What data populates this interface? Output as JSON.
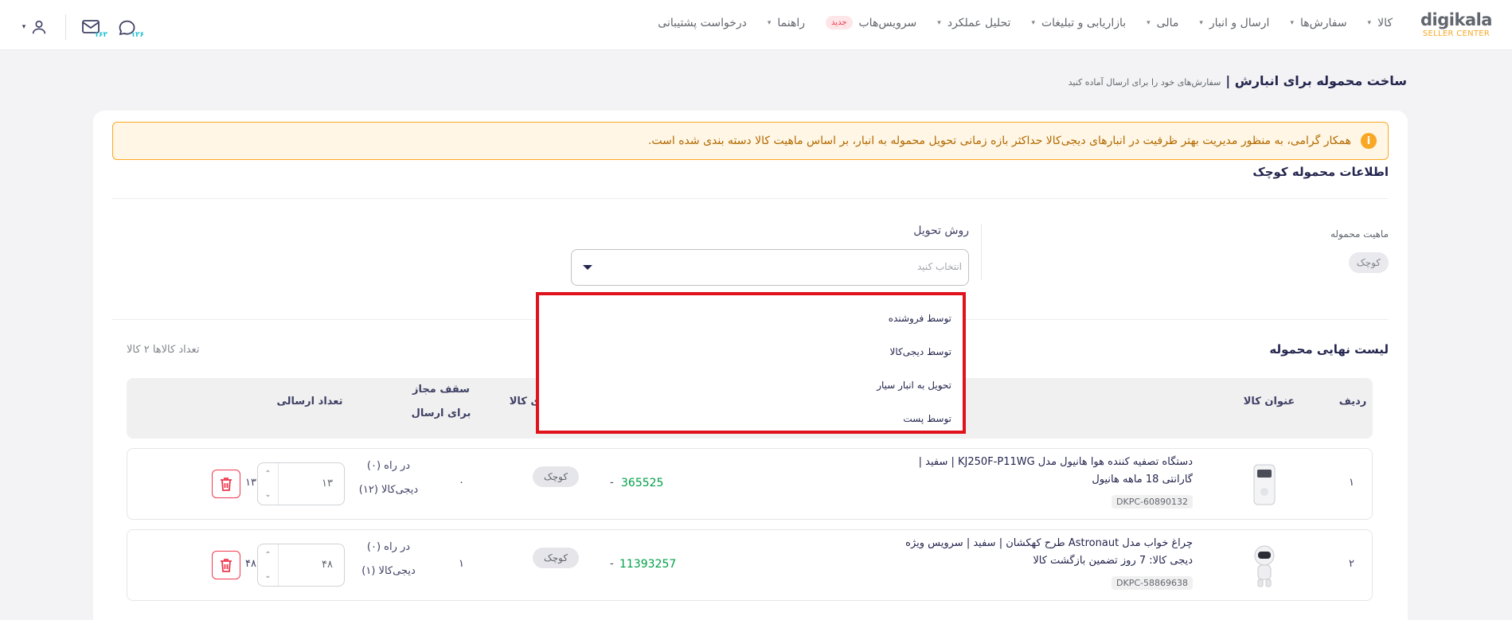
{
  "logo": {
    "line1": "digikala",
    "line2": "SELLER CENTER"
  },
  "nav": [
    {
      "label": "کالا",
      "caret": true
    },
    {
      "label": "سفارش‌ها",
      "caret": true
    },
    {
      "label": "ارسال و انبار",
      "caret": true
    },
    {
      "label": "مالی",
      "caret": true
    },
    {
      "label": "بازاریابی و تبلیغات",
      "caret": true
    },
    {
      "label": "تحلیل عملکرد",
      "caret": true
    },
    {
      "label": "سرویس‌هاب",
      "caret": false,
      "badge": "جدید"
    },
    {
      "label": "راهنما",
      "caret": true
    },
    {
      "label": "درخواست پشتیبانی",
      "caret": false
    }
  ],
  "top_icons": {
    "messages_count": "۱۶۲",
    "sync_count": "۱۲۶"
  },
  "header": {
    "title": "ساخت محموله برای انبارش |",
    "subtitle": "سفارش‌های خود را برای ارسال آماده کنید"
  },
  "alert": {
    "text": "همکار گرامی، به منظور مدیریت بهتر ظرفیت در انبارهای دیجی‌کالا حداکثر بازه زمانی تحویل محموله به انبار، بر اساس ماهیت کالا دسته بندی شده است."
  },
  "section": {
    "title": "اطلاعات محموله کوچک"
  },
  "nature": {
    "label": "ماهیت محموله",
    "value": "کوچک"
  },
  "delivery": {
    "label": "روش تحویل",
    "placeholder": "انتخاب کنید",
    "options": [
      "توسط فروشنده",
      "توسط دیجی‌کالا",
      "تحویل به انبار سیار",
      "توسط پست"
    ]
  },
  "list": {
    "title": "لیست نهایی محموله",
    "count": "تعداد کالاها ۲ کالا"
  },
  "table": {
    "headers": {
      "row": "ردیف",
      "title": "عنوان کالا",
      "dkp_partial": "ی کالا",
      "cap_line1": "سقف مجاز",
      "cap_line2": "برای ارسال",
      "qty": "تعداد ارسالی"
    },
    "rows": [
      {
        "index": "۱",
        "name": "دستگاه تصفیه کننده هوا هانیول مدل KJ250F-P11WG | سفید | گارانتی 18 ماهه هانیول",
        "dkpc": "DKPC-60890132",
        "code": "365525",
        "dash": "-",
        "size": "کوچک",
        "zero": "۰",
        "transit": "در راه (۰)",
        "dk": "دیجی‌کالا (۱۲)",
        "cap": "۱۳",
        "qty": "۱۳"
      },
      {
        "index": "۲",
        "name": "چراغ خواب مدل Astronaut طرح کهکشان | سفید | سرویس ویژه دیجی کالا: 7 روز تضمین بازگشت کالا",
        "dkpc": "DKPC-58869638",
        "code": "11393257",
        "dash": "-",
        "size": "کوچک",
        "zero": "۱",
        "transit": "در راه (۰)",
        "dk": "دیجی‌کالا (۱)",
        "cap": "۴۸",
        "qty": "۴۸"
      }
    ]
  },
  "colors": {
    "accent": "#19bfd3",
    "danger": "#ef394e",
    "warning": "#f9a825",
    "highlight": "#e0121c"
  }
}
